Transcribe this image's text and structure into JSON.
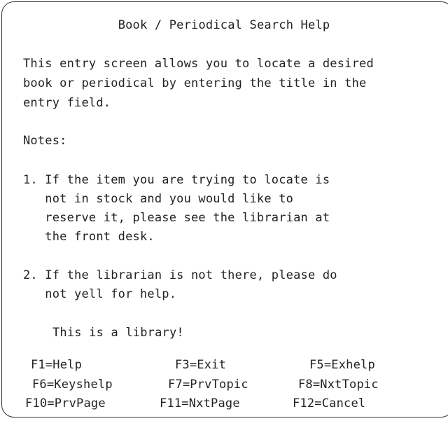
{
  "window": {
    "title": "Book / Periodical Search Help"
  },
  "body": {
    "intro_lines": [
      "This entry screen allows you to locate a desired",
      "book or periodical by entering the title in the",
      "entry field."
    ],
    "notes_heading": "Notes:",
    "note1_lines": [
      "1. If the item you are trying to locate is",
      "   not in stock and you would like to",
      "   reserve it, please see the librarian at",
      "   the front desk."
    ],
    "note2_lines": [
      "2. If the librarian is not there, please do",
      "   not yell for help."
    ],
    "closing": "This is a library!"
  },
  "function_keys": {
    "f1": "F1=Help",
    "f3": "F3=Exit",
    "f5": "F5=Exhelp",
    "f6": "F6=Keyshelp",
    "f7": "F7=PrvTopic",
    "f8": "F8=NxtTopic",
    "f10": "F10=PrvPage",
    "f11": "F11=NxtPage",
    "f12": "F12=Cancel"
  }
}
